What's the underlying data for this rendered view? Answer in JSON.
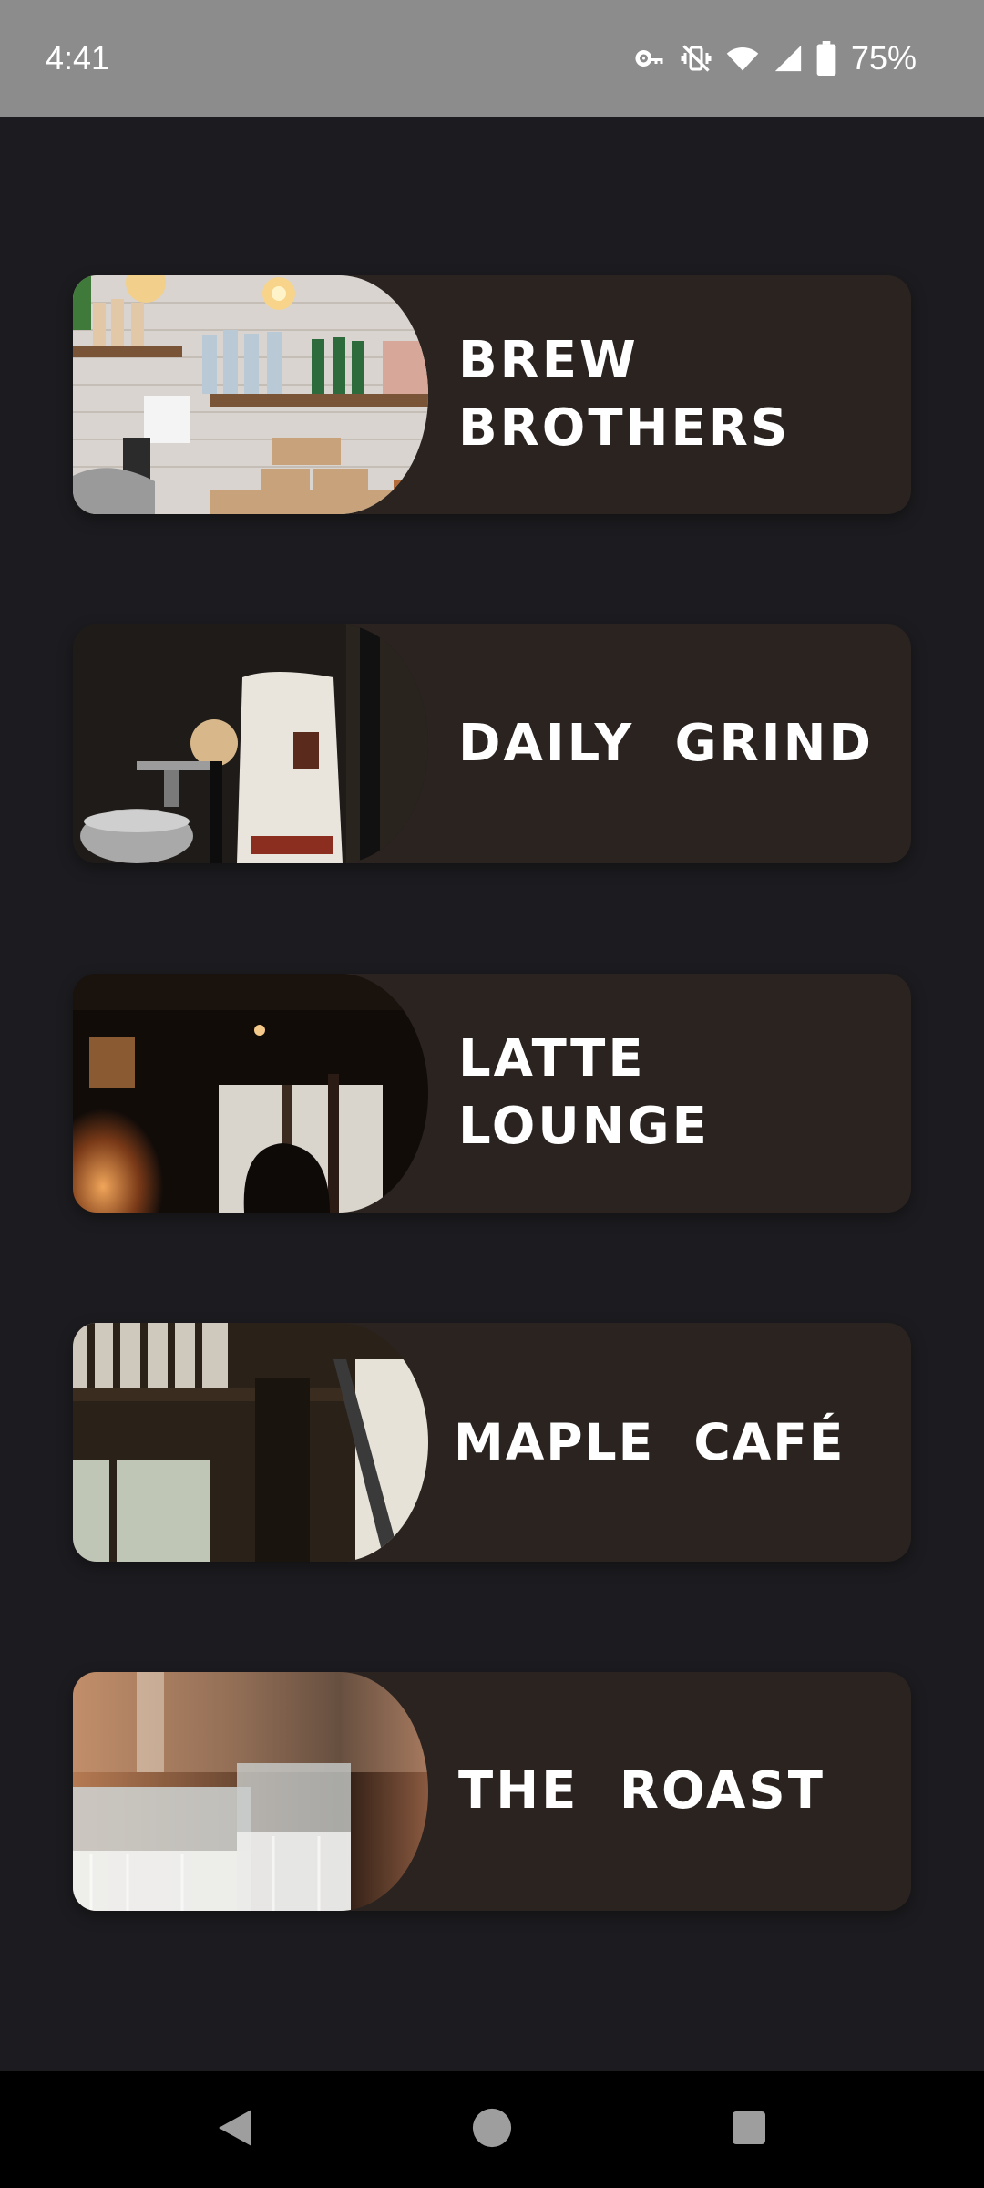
{
  "status_bar": {
    "time": "4:41",
    "icons": [
      "vpn-key-icon",
      "vibrate-off-icon",
      "wifi-icon",
      "cell-signal-icon",
      "battery-icon"
    ],
    "battery": "75%"
  },
  "cafes": [
    {
      "name": "BREW BROTHERS"
    },
    {
      "name": "DAILY GRIND"
    },
    {
      "name": "LATTE LOUNGE"
    },
    {
      "name": "MAPLE CAFÉ"
    },
    {
      "name": "THE ROAST"
    }
  ],
  "nav_bar": {
    "icons": [
      "back-icon",
      "home-icon",
      "recents-icon"
    ]
  },
  "colors": {
    "background": "#1c1b1f",
    "card": "#2a2320",
    "status_bar": "#8c8c8c",
    "nav_bar": "#000000",
    "text": "#ffffff"
  }
}
